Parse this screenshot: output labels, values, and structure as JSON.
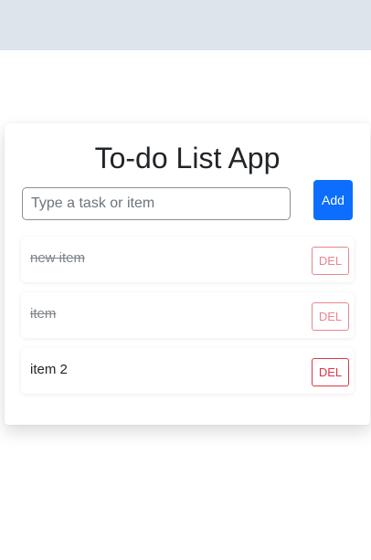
{
  "app": {
    "title": "To-do List App"
  },
  "form": {
    "placeholder": "Type a task or item",
    "value": "",
    "add_label": "Add"
  },
  "items": [
    {
      "text": "new item",
      "completed": true,
      "del_label": "DEL"
    },
    {
      "text": "item",
      "completed": true,
      "del_label": "DEL"
    },
    {
      "text": "item 2",
      "completed": false,
      "del_label": "DEL"
    }
  ],
  "colors": {
    "top_band": "#dde4ec",
    "primary": "#0d6efd",
    "danger": "#dc3545"
  }
}
